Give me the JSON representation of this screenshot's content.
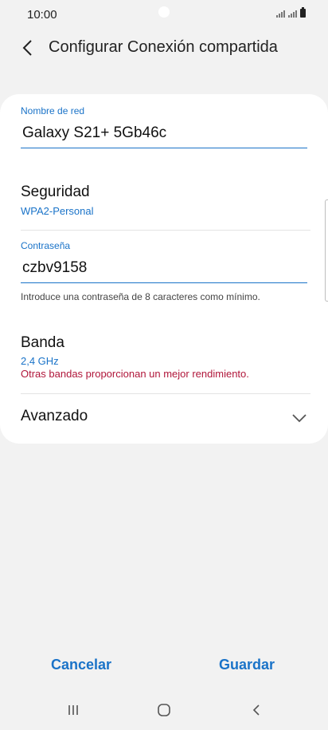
{
  "status_bar": {
    "time": "10:00"
  },
  "header": {
    "title": "Configurar Conexión compartida",
    "back_icon": "chevron-left-icon"
  },
  "network_name": {
    "label": "Nombre de red",
    "value": "Galaxy S21+ 5Gb46c"
  },
  "security": {
    "title": "Seguridad",
    "value": "WPA2-Personal"
  },
  "password": {
    "label": "Contraseña",
    "value": "czbv9158",
    "helper": "Introduce una contraseña de 8 caracteres como mínimo."
  },
  "band": {
    "title": "Banda",
    "value": "2,4 GHz",
    "warning": "Otras bandas proporcionan un mejor rendimiento."
  },
  "advanced": {
    "title": "Avanzado",
    "icon": "chevron-down-icon"
  },
  "actions": {
    "cancel_label": "Cancelar",
    "save_label": "Guardar"
  },
  "nav_bar": {
    "recent_icon": "recent-apps-icon",
    "home_icon": "home-icon",
    "back_icon": "nav-back-icon"
  },
  "colors": {
    "accent": "#1a73c8",
    "warning": "#b0163a",
    "background": "#f2f2f2",
    "card": "#ffffff"
  }
}
